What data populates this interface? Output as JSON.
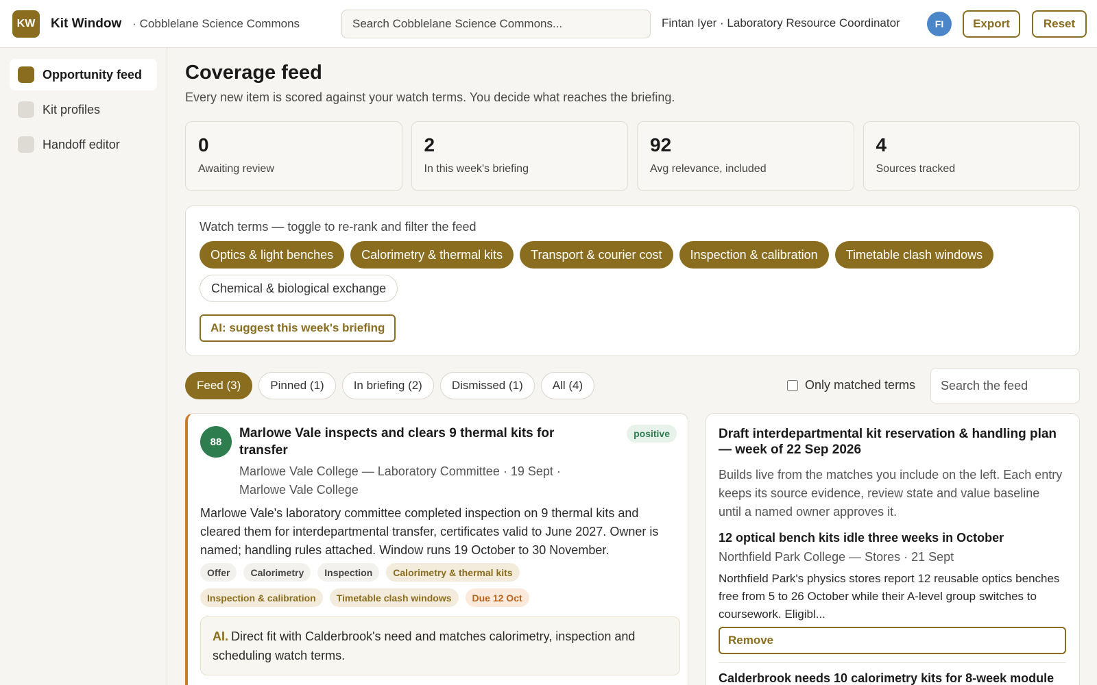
{
  "header": {
    "logo": "KW",
    "app_title": "Kit Window",
    "org": "· Cobblelane Science Commons",
    "search_placeholder": "Search Cobblelane Science Commons...",
    "user": "Fintan Iyer · Laboratory Resource Coordinator",
    "avatar": "FI",
    "export_label": "Export",
    "reset_label": "Reset",
    "accent_color": "#8a6d1e"
  },
  "sidebar": {
    "items": [
      {
        "label": "Opportunity feed",
        "active": true
      },
      {
        "label": "Kit profiles",
        "active": false
      },
      {
        "label": "Handoff editor",
        "active": false
      }
    ]
  },
  "main": {
    "title": "Coverage feed",
    "subtitle": "Every new item is scored against your watch terms. You decide what reaches the briefing.",
    "stats": [
      {
        "value": "0",
        "label": "Awaiting review"
      },
      {
        "value": "2",
        "label": "In this week's briefing"
      },
      {
        "value": "92",
        "label": "Avg relevance, included"
      },
      {
        "value": "4",
        "label": "Sources tracked"
      }
    ],
    "watch": {
      "title": "Watch terms — toggle to re-rank and filter the feed",
      "terms": [
        {
          "label": "Optics & light benches",
          "on": true
        },
        {
          "label": "Calorimetry & thermal kits",
          "on": true
        },
        {
          "label": "Transport & courier cost",
          "on": true
        },
        {
          "label": "Inspection & calibration",
          "on": true
        },
        {
          "label": "Timetable clash windows",
          "on": true
        },
        {
          "label": "Chemical & biological exchange",
          "on": false
        }
      ],
      "ai_button": "AI: suggest this week's briefing"
    },
    "tabs": [
      {
        "label": "Feed (3)",
        "active": true
      },
      {
        "label": "Pinned (1)",
        "active": false
      },
      {
        "label": "In briefing (2)",
        "active": false
      },
      {
        "label": "Dismissed (1)",
        "active": false
      },
      {
        "label": "All (4)",
        "active": false
      }
    ],
    "only_matched_label": "Only matched terms",
    "feed_search_placeholder": "Search the feed"
  },
  "feed_card": {
    "score": "88",
    "title": "Marlowe Vale inspects and clears 9 thermal kits for transfer",
    "sentiment": "positive",
    "meta": "Marlowe Vale College — Laboratory Committee · 19 Sept · Marlowe Vale College",
    "body": "Marlowe Vale's laboratory committee completed inspection on 9 thermal kits and cleared them for interdepartmental transfer, certificates valid to June 2027. Owner is named; handling rules attached. Window runs 19 October to 30 November.",
    "tags": [
      {
        "label": "Offer",
        "kind": "plain"
      },
      {
        "label": "Calorimetry",
        "kind": "plain"
      },
      {
        "label": "Inspection",
        "kind": "plain"
      },
      {
        "label": "Calorimetry & thermal kits",
        "kind": "match"
      },
      {
        "label": "Inspection & calibration",
        "kind": "match"
      },
      {
        "label": "Timetable clash windows",
        "kind": "match"
      },
      {
        "label": "Due 12 Oct",
        "kind": "due"
      }
    ],
    "ai_label": "AI.",
    "ai_note": "Direct fit with Calderbrook's need and matches calorimetry, inspection and scheduling watch terms."
  },
  "briefing": {
    "title": "Draft interdepartmental kit reservation & handling plan — week of 22 Sep 2026",
    "description": "Builds live from the matches you include on the left. Each entry keeps its source evidence, review state and value baseline until a named owner approves it.",
    "item": {
      "title": "12 optical bench kits idle three weeks in October",
      "meta": "Northfield Park College — Stores · 21 Sept",
      "body": "Northfield Park's physics stores report 12 reusable optics benches free from 5 to 26 October while their A-level group switches to coursework. Eligibl...",
      "remove_label": "Remove"
    },
    "next_title": "Calderbrook needs 10 calorimetry kits for 8-week module"
  }
}
